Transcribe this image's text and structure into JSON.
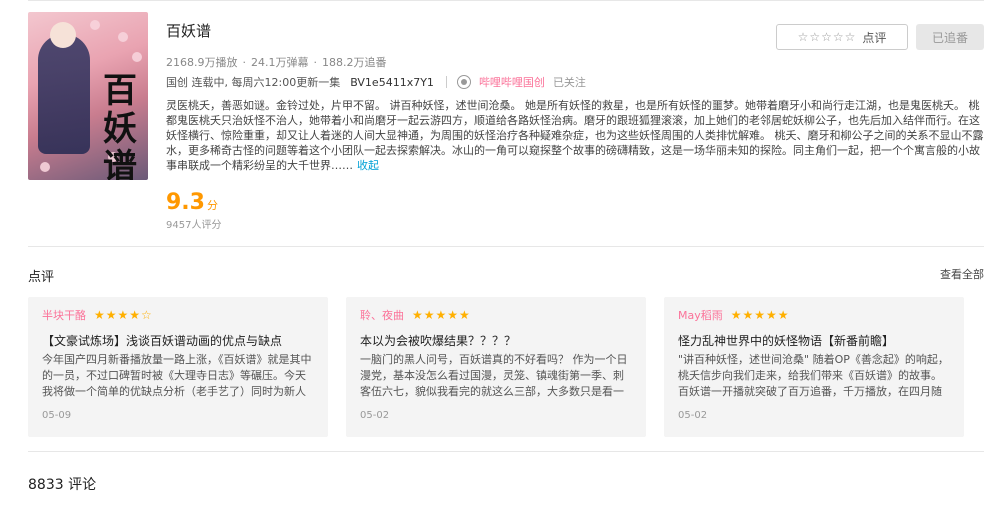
{
  "header": {
    "title": "百妖谱",
    "stats": {
      "plays": "2168.9万播放",
      "danmaku": "24.1万弹幕",
      "follows": "188.2万追番",
      "separator": "·"
    },
    "meta": {
      "info": "国创  连载中, 每周六12:00更新一集",
      "bvid": "BV1e5411x7Y1",
      "official": "哔哩哔哩国创",
      "followed": "已关注"
    },
    "description": "灵医桃夭，善恶如谜。金铃过处，片甲不留。 讲百种妖怪，述世间沧桑。 她是所有妖怪的救星，也是所有妖怪的噩梦。她带着磨牙小和尚行走江湖，也是鬼医桃夭。 桃都鬼医桃夭只治妖怪不治人，她带着小和尚磨牙一起云游四方，顺道给各路妖怪治病。磨牙的跟班狐狸滚滚，加上她们的老邻居蛇妖柳公子，也先后加入结伴而行。在这妖怪横行、惊险重重，却又让人着迷的人间大显神通，为周围的妖怪治疗各种疑难杂症，也为这些妖怪周围的人类排忧解难。 桃夭、磨牙和柳公子之间的关系不显山不露水，更多稀奇古怪的问题等着这个小团队一起去探索解决。冰山的一角可以窥探整个故事的磅礴精致，这是一场华丽未知的探险。同主角们一起，把一个个寓言般的小故事串联成一个精彩纷呈的大千世界……",
    "collapse": "收起",
    "score": "9.3",
    "score_unit": "分",
    "raters": "9457人评分",
    "rate_button": {
      "stars": "☆☆☆☆☆",
      "label": "点评"
    },
    "follow_button": "已追番",
    "cover_calligraphy": "百妖谱"
  },
  "reviews_section": {
    "title": "点评",
    "view_all": "查看全部",
    "cards": [
      {
        "user": "半块干酪",
        "stars": "★★★★☆",
        "title": "【文豪试炼场】浅谈百妖谱动画的优点与缺点",
        "body": "今年国产四月新番播放量一路上涨，《百妖谱》就是其中的一员，不过口碑暂时被《大理寺日志》等碾压。今天我将做一个简单的优缺点分析（老手艺了）同时为新人分...",
        "date": "05-09"
      },
      {
        "user": "聆、夜曲",
        "stars": "★★★★★",
        "title": "本以为会被吹爆结果？？？？",
        "body": "一脑门的黑人问号，百妖谱真的不好看吗？ 作为一个日漫党，基本没怎么看过国漫，灵笼、镇魂街第一季、刺客伍六七，貌似我看完的就这么三部，大多数只是看一两...",
        "date": "05-02"
      },
      {
        "user": "May稻雨",
        "stars": "★★★★★",
        "title": "怪力乱神世界中的妖怪物语【新番前瞻】",
        "body": "\"讲百种妖怪，述世间沧桑\" 随着OP《善念起》的响起，桃夭信步向我们走来，给我们带来《百妖谱》的故事。百妖谱一开播就突破了百万追番，千万播放，在四月随着《大理...",
        "date": "05-02"
      }
    ]
  },
  "comments": {
    "count_label": "8833  评论"
  }
}
